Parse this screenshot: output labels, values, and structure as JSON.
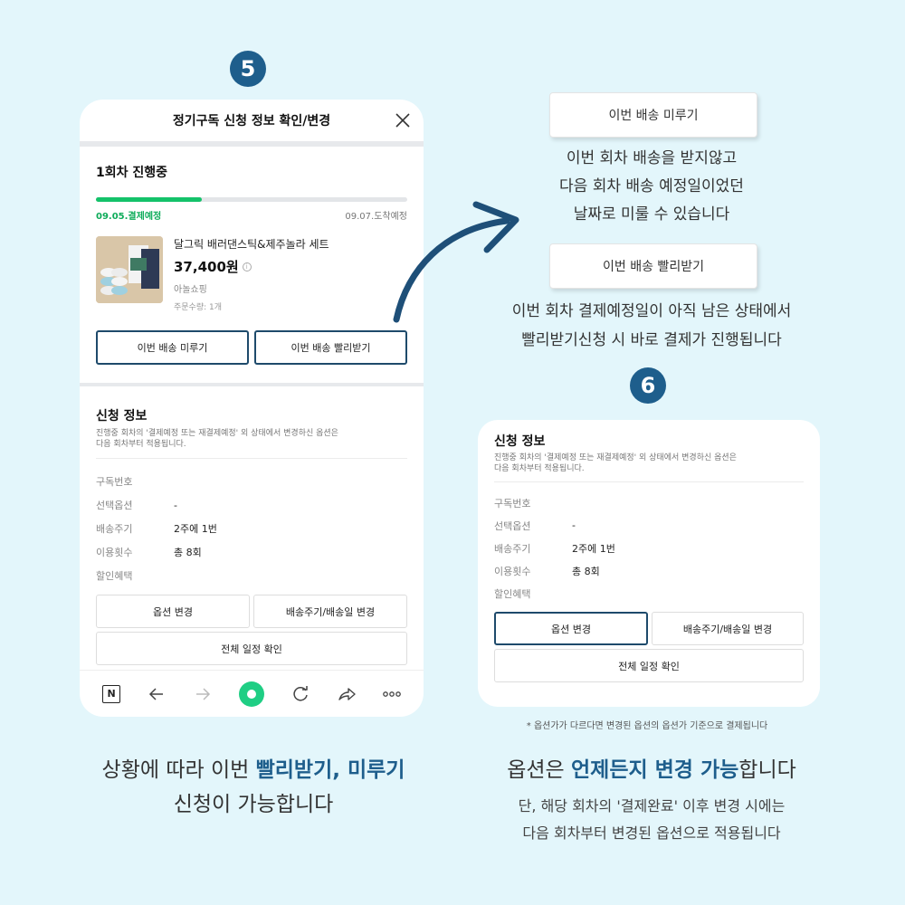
{
  "step5": "5",
  "step6": "6",
  "phone": {
    "title": "정기구독 신청 정보 확인/변경",
    "status_title": "1회차 진행중",
    "progress": 0.34,
    "progress_left": "09.05.결제예정",
    "progress_right": "09.07.도착예정",
    "product_name": "달그릭 배러댄스틱&제주놀라 세트",
    "product_price": "37,400원",
    "product_seller": "아놀쇼핑",
    "product_qty": "주문수량: 1개",
    "btn_delay": "이번 배송 미루기",
    "btn_fast": "이번 배송 빨리받기",
    "info_title": "신청 정보",
    "info_desc_1": "진행중 회차의 '결제예정 또는 재결제예정' 외 상태에서 변경하신 옵션은",
    "info_desc_2": "다음 회차부터 적용됩니다.",
    "rows": [
      {
        "key": "구독번호",
        "val": ""
      },
      {
        "key": "선택옵션",
        "val": "-"
      },
      {
        "key": "배송주기",
        "val": "2주에 1번"
      },
      {
        "key": "이용횟수",
        "val": "총 8회"
      },
      {
        "key": "할인혜택",
        "val": ""
      }
    ],
    "btn_option": "옵션 변경",
    "btn_cycle": "배송주기/배송일 변경",
    "btn_schedule": "전체 일정 확인",
    "nav_n": "N"
  },
  "right": {
    "delay_btn": "이번 배송 미루기",
    "delay_desc_1": "이번 회차 배송을 받지않고",
    "delay_desc_2": "다음 회차 배송 예정일이었던",
    "delay_desc_3": "날짜로 미룰 수 있습니다",
    "fast_btn": "이번 배송 빨리받기",
    "fast_desc_1": "이번 회차 결제예정일이 아직 남은 상태에서",
    "fast_desc_2": "빨리받기신청 시 바로 결제가 진행됩니다"
  },
  "card2": {
    "info_title": "신청 정보",
    "info_desc_1": "진행중 회차의 '결제예정 또는 재결제예정' 외 상태에서 변경하신 옵션은",
    "info_desc_2": "다음 회차부터 적용됩니다.",
    "rows": [
      {
        "key": "구독번호",
        "val": ""
      },
      {
        "key": "선택옵션",
        "val": "-"
      },
      {
        "key": "배송주기",
        "val": "2주에 1번"
      },
      {
        "key": "이용횟수",
        "val": "총 8회"
      },
      {
        "key": "할인혜택",
        "val": ""
      }
    ],
    "btn_option": "옵션 변경",
    "btn_cycle": "배송주기/배송일 변경",
    "btn_schedule": "전체 일정 확인",
    "footnote": "* 옵션가가 다르다면 변경된 옵션의 옵션가 기준으로 결제됩니다"
  },
  "caption_left": {
    "l1_a": "상황에 따라 이번 ",
    "l1_b": "빨리받기, 미루기",
    "l2": "신청이 가능합니다"
  },
  "caption_right": {
    "l1_a": "옵션은 ",
    "l1_b": "언제든지 변경 가능",
    "l1_c": "합니다",
    "l2": "단, 해당 회차의 '결제완료' 이후 변경 시에는",
    "l3": "다음 회차부터 변경된 옵션으로 적용됩니다"
  },
  "colors": {
    "accent": "#1e5e8c",
    "green": "#14c26a",
    "bg": "#e3f6fb"
  }
}
